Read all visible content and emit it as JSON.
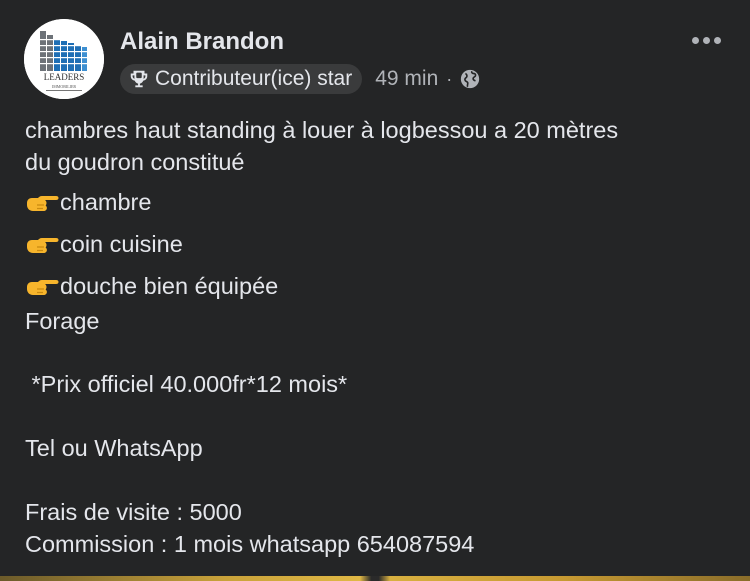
{
  "post": {
    "author": {
      "name": "Alain Brandon",
      "avatar_logo_text": "LEADERS IMMOBILIER"
    },
    "badge": {
      "icon": "trophy-icon",
      "label": "Contributeur(ice) star"
    },
    "time": "49 min",
    "separator": "·",
    "privacy_icon": "globe-icon",
    "more_icon": "more-dots-icon",
    "text": {
      "line1": "chambres haut standing  à louer à logbessou a 20 mètres",
      "line2": "du goudron constitué",
      "bullet_icon": "pointing-finger-emoji",
      "bullets": [
        "chambre",
        "coin cuisine",
        "douche bien équipée"
      ],
      "line_forage": "Forage",
      "line_price": " *Prix officiel 40.000fr*12 mois*",
      "line_contact": "Tel ou WhatsApp",
      "line_fees": "Frais de visite : 5000",
      "line_commission": "Commission : 1 mois whatsapp 654087594"
    }
  },
  "colors": {
    "background": "#242526",
    "text_primary": "#e4e6eb",
    "text_secondary": "#b0b3b8",
    "badge_bg": "#3a3b3c",
    "emoji_yellow": "#f7b52c"
  }
}
